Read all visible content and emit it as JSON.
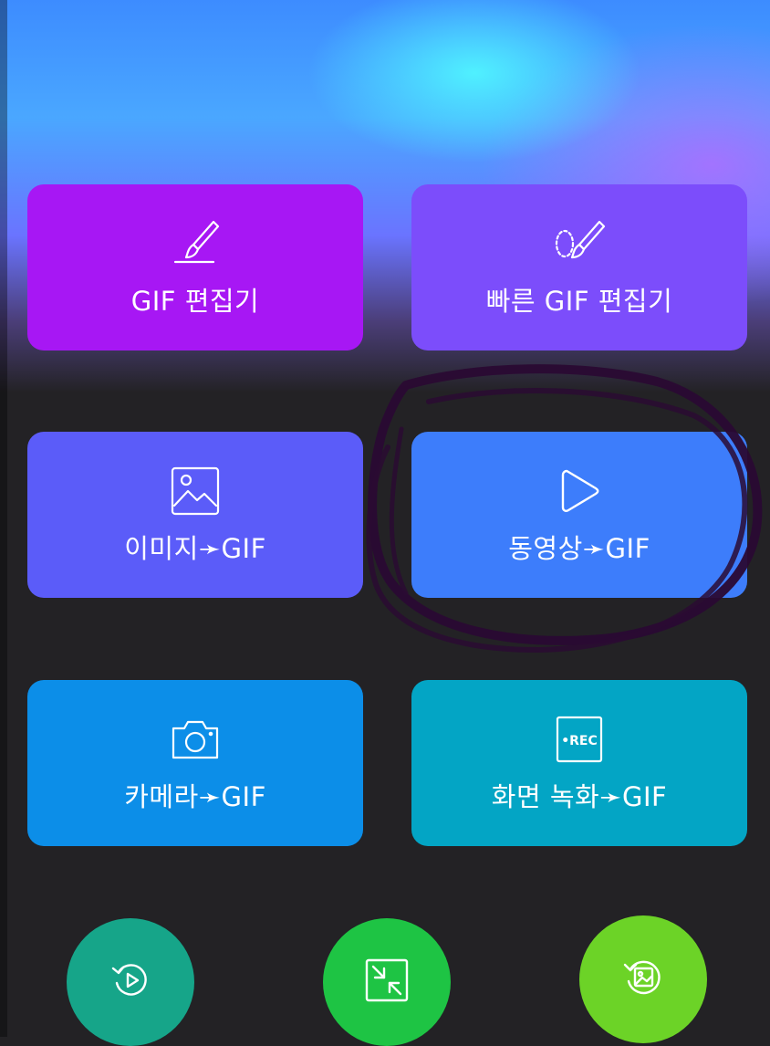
{
  "tiles": {
    "gif_editor": {
      "label": "GIF 편집기",
      "icon": "paintbrush-icon",
      "color": "#a717f4"
    },
    "quick_gif_editor": {
      "label": "빠른 GIF 편집기",
      "icon": "paintbrush-lasso-icon",
      "color": "#7c4dfb"
    },
    "image_to_gif": {
      "label": "이미지➛GIF",
      "icon": "image-icon",
      "color": "#5b5cf9"
    },
    "video_to_gif": {
      "label": "동영상➛GIF",
      "icon": "play-icon",
      "color": "#3d7dfb"
    },
    "camera_to_gif": {
      "label": "카메라➛GIF",
      "icon": "camera-icon",
      "color": "#0c8ee8"
    },
    "screen_record_to_gif": {
      "label": "화면 녹화➛GIF",
      "icon_text": "•REC",
      "icon": "rec-icon",
      "color": "#03a5c5"
    }
  },
  "circle_buttons": {
    "reverse_video": {
      "icon": "reverse-video-icon",
      "color": "#16a589"
    },
    "compress": {
      "icon": "compress-icon",
      "color": "#1ec444"
    },
    "reverse_image": {
      "icon": "reverse-image-icon",
      "color": "#6cd327"
    }
  },
  "annotation": {
    "color": "#2a0a33"
  }
}
